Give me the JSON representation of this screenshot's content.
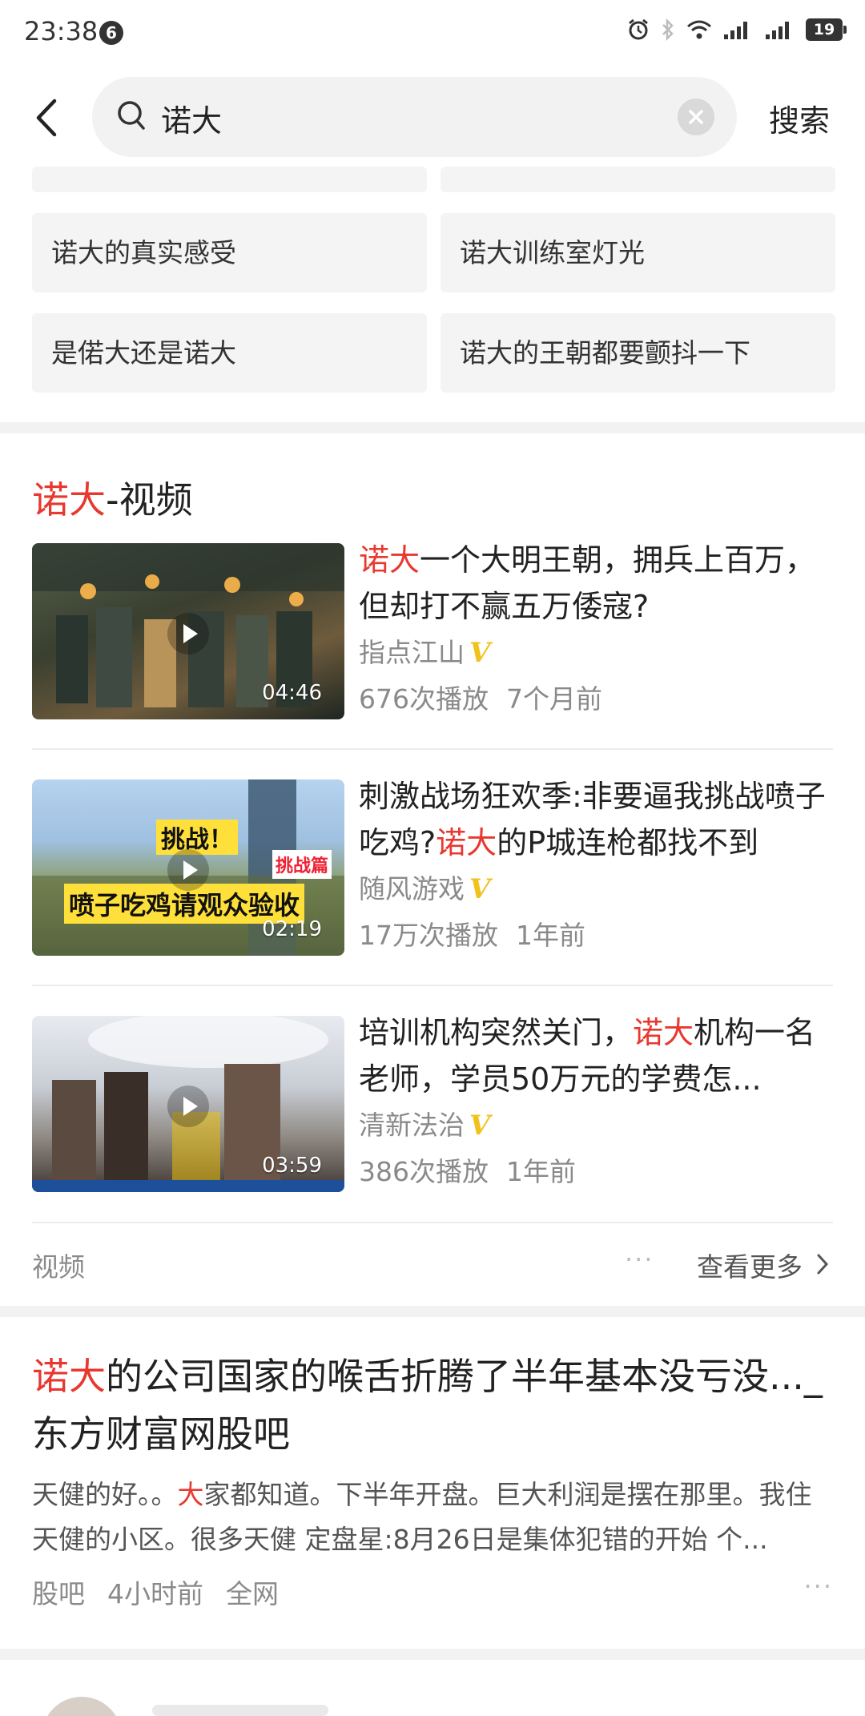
{
  "status_bar": {
    "time": "23:38",
    "notification_count": "6",
    "battery": "19"
  },
  "search": {
    "query": "诺大",
    "button": "搜索"
  },
  "suggestions": [
    "诺大的真实感受",
    "诺大训练室灯光",
    "是偌大还是诺大",
    "诺大的王朝都要颤抖一下"
  ],
  "video_section": {
    "title_highlight": "诺大",
    "title_rest": "-视频",
    "footer_label": "视频",
    "footer_dots": "···",
    "more_label": "查看更多",
    "videos": [
      {
        "title_pre": "",
        "title_hl": "诺大",
        "title_post": "一个大明王朝，拥兵上百万，但却打不赢五万倭寇?",
        "author": "指点江山",
        "badge": "V",
        "plays": "676次播放",
        "time": "7个月前",
        "duration": "04:46",
        "thumb_colors": [
          "#3b4a3d",
          "#6b5a3a",
          "#1f2a25"
        ]
      },
      {
        "title_pre": "刺激战场狂欢季:非要逼我挑战喷子吃鸡?",
        "title_hl": "诺大",
        "title_post": "的P城连枪都找不到",
        "author": "随风游戏",
        "badge": "V",
        "plays": "17万次播放",
        "time": "1年前",
        "duration": "02:19",
        "thumb_colors": [
          "#a9c7e6",
          "#7a9a5e",
          "#4a5b3a"
        ],
        "overlay_top": "挑战！",
        "overlay_bottom": "喷子吃鸡请观众验收",
        "overlay_tag": "挑战篇"
      },
      {
        "title_pre": "培训机构突然关门，",
        "title_hl": "诺大",
        "title_post": "机构一名老师，学员50万元的学费怎...",
        "author": "清新法治",
        "badge": "V",
        "plays": "386次播放",
        "time": "1年前",
        "duration": "03:59",
        "thumb_colors": [
          "#dfe3ea",
          "#9aa0a8",
          "#5a4d45"
        ]
      }
    ]
  },
  "article": {
    "title_hl": "诺大",
    "title_rest": "的公司国家的喉舌折腾了半年基本没亏没..._东方财富网股吧",
    "body_pre": "天健的好。。",
    "body_hl": "大",
    "body_post": "家都知道。下半年开盘。巨大利润是摆在那里。我住天健的小区。很多天健 定盘星:8月26日是集体犯错的开始 个...",
    "source": "股吧",
    "time": "4小时前",
    "scope": "全网",
    "dots": "···"
  }
}
